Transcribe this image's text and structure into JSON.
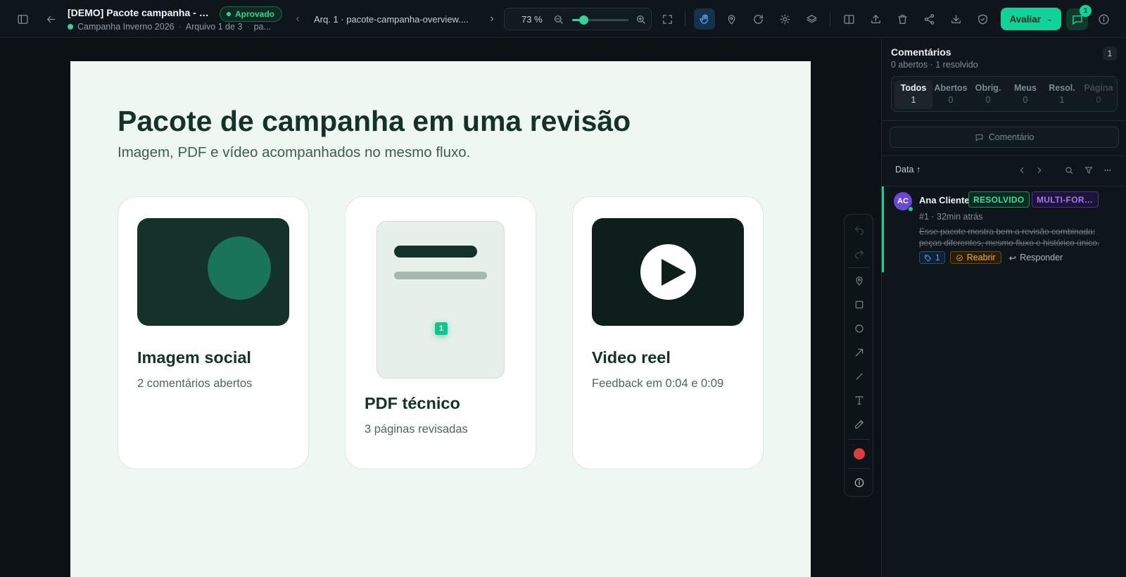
{
  "header": {
    "title": "[DEMO] Pacote campanha - m...",
    "status": "Aprovado",
    "campaign": "Campanha Inverno 2026",
    "file_position": "Arquivo 1 de 3",
    "file_short": "pa...",
    "file_name": "Arq. 1 · pacote-campanha-overview....",
    "zoom": "73 %",
    "zoom_fraction": 0.2,
    "review_button": "Avaliar",
    "comments_badge": "1"
  },
  "document": {
    "title": "Pacote de campanha em uma revisão",
    "subtitle": "Imagem, PDF e vídeo acompanhados no mesmo fluxo.",
    "cards": [
      {
        "title": "Imagem social",
        "desc": "2 comentários abertos"
      },
      {
        "title": "PDF técnico",
        "desc": "3 páginas revisadas",
        "pin": "1"
      },
      {
        "title": "Video reel",
        "desc": "Feedback em 0:04 e 0:09"
      }
    ]
  },
  "panel": {
    "title": "Comentários",
    "summary": "0 abertos · 1 resolvido",
    "count": "1",
    "filters": [
      {
        "label": "Todos",
        "count": "1"
      },
      {
        "label": "Abertos",
        "count": "0"
      },
      {
        "label": "Obrig.",
        "count": "0"
      },
      {
        "label": "Meus",
        "count": "0"
      },
      {
        "label": "Resol.",
        "count": "1"
      },
      {
        "label": "Página",
        "count": "0"
      }
    ],
    "add_comment": "Comentário",
    "sort_label": "Data ↑",
    "comments": [
      {
        "avatar": "AC",
        "author": "Ana Cliente",
        "status_tag": "RESOLVIDO",
        "scope_tag": "MULTI-FORMATO",
        "meta": "#1 · 32min atrás",
        "body": "Esse pacote mostra bem a revisão combinada: peças diferentes, mesmo fluxo e histórico único.",
        "tag_count": "1",
        "reopen": "Reabrir",
        "reply": "Responder"
      }
    ]
  },
  "colors": {
    "accent": "#10d39a",
    "approved": "#34d399",
    "resolved": "#2ee0a2",
    "multi": "#a277ff",
    "reopen": "#f0b232",
    "link": "#5aa8ff",
    "page_bg": "#eff7f3",
    "ink": "#143229"
  }
}
